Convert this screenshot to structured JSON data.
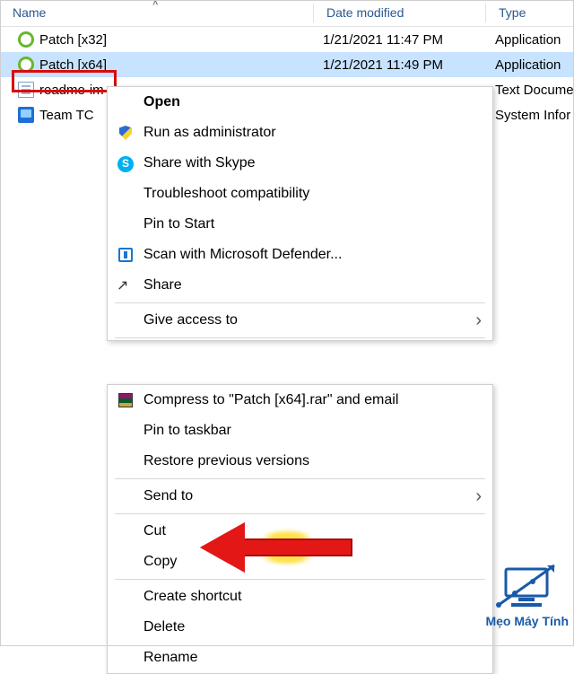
{
  "columns": {
    "name": "Name",
    "date": "Date modified",
    "type": "Type"
  },
  "files": [
    {
      "name": "Patch [x32]",
      "date": "1/21/2021 11:47 PM",
      "type": "Application",
      "icon": "app"
    },
    {
      "name": "Patch [x64]",
      "date": "1/21/2021 11:49 PM",
      "type": "Application",
      "icon": "app"
    },
    {
      "name": "readme-im",
      "date": "",
      "type": "Text Docume",
      "icon": "txt"
    },
    {
      "name": "Team TC",
      "date": "",
      "type": "System Infor",
      "icon": "sys"
    }
  ],
  "menu": {
    "open": "Open",
    "runas": "Run as administrator",
    "skype": "Share with Skype",
    "troubleshoot": "Troubleshoot compatibility",
    "pin_start": "Pin to Start",
    "defender": "Scan with Microsoft Defender...",
    "share": "Share",
    "give_access": "Give access to",
    "compress": "Compress to \"Patch [x64].rar\" and email",
    "pin_taskbar": "Pin to taskbar",
    "restore": "Restore previous versions",
    "send_to": "Send to",
    "cut": "Cut",
    "copy": "Copy",
    "create_shortcut": "Create shortcut",
    "delete": "Delete",
    "rename": "Rename"
  },
  "watermark": "Mẹo Máy Tính"
}
